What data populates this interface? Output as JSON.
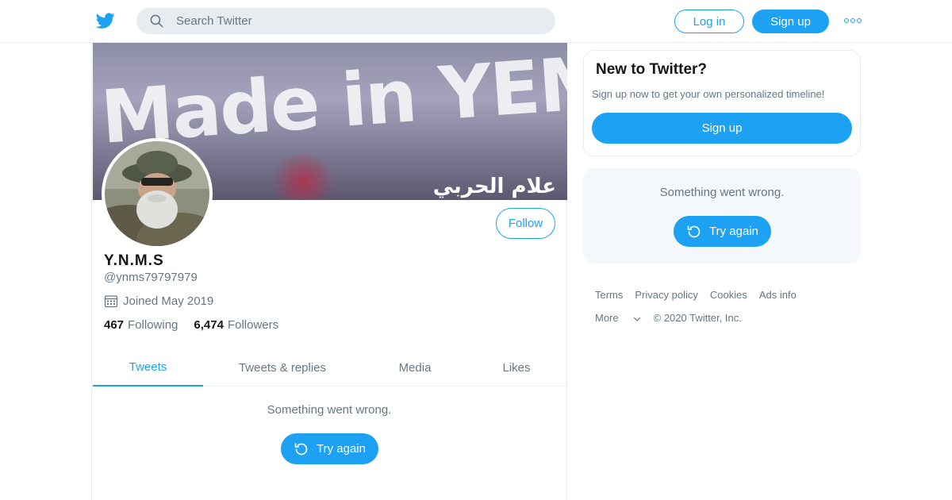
{
  "header": {
    "search_placeholder": "Search Twitter",
    "login_label": "Log in",
    "signup_label": "Sign up",
    "more_icon": "more-dots-icon",
    "logo_icon": "twitter-bird-icon"
  },
  "profile": {
    "banner_text": "Made in YEMEN",
    "banner_arabic": "علام الحربي",
    "display_name": "Y.N.M.S",
    "handle": "@ynms79797979",
    "joined": "Joined May 2019",
    "following_count": "467",
    "following_label": "Following",
    "followers_count": "6,474",
    "followers_label": "Followers",
    "follow_label": "Follow"
  },
  "tabs": [
    {
      "label": "Tweets",
      "active": true
    },
    {
      "label": "Tweets & replies",
      "active": false
    },
    {
      "label": "Media",
      "active": false
    },
    {
      "label": "Likes",
      "active": false
    }
  ],
  "timeline": {
    "error_text": "Something went wrong.",
    "retry_label": "Try again"
  },
  "sidebar": {
    "new_title": "New to Twitter?",
    "new_subtitle": "Sign up now to get your own personalized timeline!",
    "signup_label": "Sign up",
    "error_text": "Something went wrong.",
    "retry_label": "Try again"
  },
  "footer": {
    "links": [
      "Terms",
      "Privacy policy",
      "Cookies",
      "Ads info"
    ],
    "more_label": "More",
    "copyright": "© 2020 Twitter, Inc."
  },
  "colors": {
    "accent": "#1da1f2",
    "secondary_text": "#657786",
    "border": "#e6ecf0"
  }
}
